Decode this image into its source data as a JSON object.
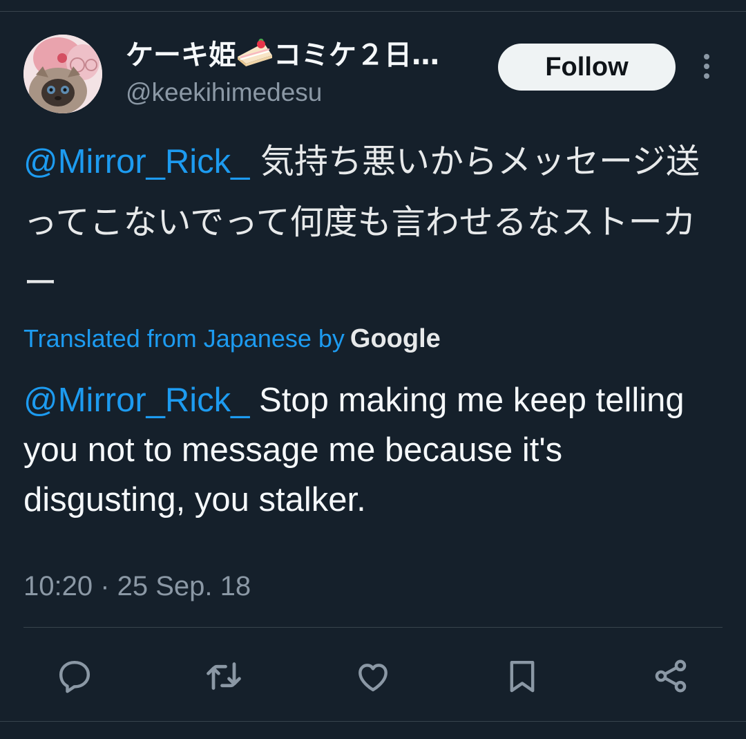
{
  "author": {
    "display_name_before": "ケーキ姫",
    "display_name_after": "コミケ２日…",
    "handle": "@keekihimedesu"
  },
  "follow_button": {
    "label": "Follow"
  },
  "tweet": {
    "mention": "@Mirror_Rick_",
    "text": " 気持ち悪いからメッセージ送ってこないでって何度も言わせるなストーカー"
  },
  "translation": {
    "label": "Translated from Japanese by",
    "provider": "Google",
    "mention": "@Mirror_Rick_",
    "text": " Stop making me keep telling you not to message me because it's disgusting, you stalker."
  },
  "timestamp": "10:20 · 25 Sep. 18",
  "actions": [
    {
      "icon": "reply-icon"
    },
    {
      "icon": "retweet-icon"
    },
    {
      "icon": "like-icon"
    },
    {
      "icon": "bookmark-icon"
    },
    {
      "icon": "share-icon"
    }
  ],
  "colors": {
    "background": "#15202b",
    "accent": "#1d9bf0",
    "secondary_text": "#8b98a5",
    "divider": "#38444d"
  }
}
